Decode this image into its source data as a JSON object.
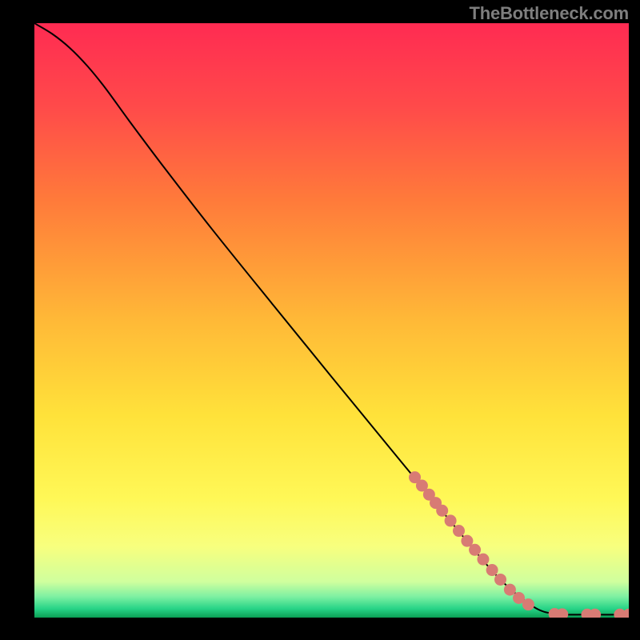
{
  "watermark": "TheBottleneck.com",
  "chart_data": {
    "type": "line",
    "title": "",
    "xlabel": "",
    "ylabel": "",
    "xlim": [
      0,
      100
    ],
    "ylim": [
      0,
      100
    ],
    "gradient_stops": [
      {
        "offset": 0,
        "color": "#ff2b52"
      },
      {
        "offset": 0.14,
        "color": "#ff4a4a"
      },
      {
        "offset": 0.3,
        "color": "#ff7b3a"
      },
      {
        "offset": 0.5,
        "color": "#ffb937"
      },
      {
        "offset": 0.66,
        "color": "#ffe23a"
      },
      {
        "offset": 0.8,
        "color": "#fff857"
      },
      {
        "offset": 0.88,
        "color": "#f8ff7e"
      },
      {
        "offset": 0.94,
        "color": "#cfff9e"
      },
      {
        "offset": 0.965,
        "color": "#7df0a2"
      },
      {
        "offset": 0.985,
        "color": "#27d487"
      },
      {
        "offset": 1.0,
        "color": "#0b9f55"
      }
    ],
    "series": [
      {
        "name": "curve",
        "type": "line",
        "color": "#000000",
        "points": [
          {
            "x": 0,
            "y": 100
          },
          {
            "x": 3,
            "y": 98.2
          },
          {
            "x": 6,
            "y": 95.8
          },
          {
            "x": 9,
            "y": 92.7
          },
          {
            "x": 12,
            "y": 89.0
          },
          {
            "x": 16,
            "y": 83.5
          },
          {
            "x": 22,
            "y": 75.5
          },
          {
            "x": 30,
            "y": 65.2
          },
          {
            "x": 40,
            "y": 52.8
          },
          {
            "x": 50,
            "y": 40.5
          },
          {
            "x": 60,
            "y": 28.3
          },
          {
            "x": 70,
            "y": 16.2
          },
          {
            "x": 78,
            "y": 6.8
          },
          {
            "x": 84,
            "y": 1.8
          },
          {
            "x": 88,
            "y": 0.6
          },
          {
            "x": 93,
            "y": 0.5
          },
          {
            "x": 100,
            "y": 0.5
          }
        ]
      },
      {
        "name": "highlighted-segment",
        "type": "scatter",
        "color": "#d87b74",
        "points": [
          {
            "x": 64,
            "y": 23.6
          },
          {
            "x": 65.2,
            "y": 22.2
          },
          {
            "x": 66.4,
            "y": 20.7
          },
          {
            "x": 67.5,
            "y": 19.3
          },
          {
            "x": 68.6,
            "y": 18.0
          },
          {
            "x": 70.0,
            "y": 16.3
          },
          {
            "x": 71.4,
            "y": 14.6
          },
          {
            "x": 72.8,
            "y": 12.9
          },
          {
            "x": 74.1,
            "y": 11.4
          },
          {
            "x": 75.5,
            "y": 9.8
          },
          {
            "x": 77.0,
            "y": 8.0
          },
          {
            "x": 78.4,
            "y": 6.4
          },
          {
            "x": 80.0,
            "y": 4.7
          },
          {
            "x": 81.5,
            "y": 3.3
          },
          {
            "x": 83.1,
            "y": 2.2
          },
          {
            "x": 87.5,
            "y": 0.6
          },
          {
            "x": 88.8,
            "y": 0.55
          },
          {
            "x": 93.0,
            "y": 0.5
          },
          {
            "x": 94.3,
            "y": 0.5
          },
          {
            "x": 98.5,
            "y": 0.5
          },
          {
            "x": 100,
            "y": 0.5
          }
        ]
      }
    ]
  }
}
